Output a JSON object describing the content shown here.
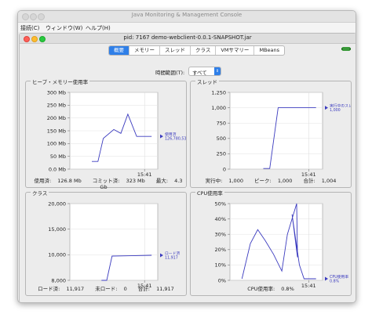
{
  "window": {
    "title": "Java Monitoring & Management Console"
  },
  "menu": [
    {
      "label": "接続(C)"
    },
    {
      "label": "ウィンドウ(W)"
    },
    {
      "label": "ヘルプ(H)"
    }
  ],
  "inner": {
    "title": "pid: 7167 demo-webclient-0.0.1-SNAPSHOT.jar"
  },
  "tabs": [
    {
      "label": "概要",
      "active": true
    },
    {
      "label": "メモリー",
      "active": false
    },
    {
      "label": "スレッド",
      "active": false
    },
    {
      "label": "クラス",
      "active": false
    },
    {
      "label": "VMサマリー",
      "active": false
    },
    {
      "label": "MBeans",
      "active": false
    }
  ],
  "time_range": {
    "label": "時間範囲(T):",
    "value": "すべて"
  },
  "colors": {
    "accent": "#2f7fe8",
    "series": "#3b3bbf",
    "plot_bg": "#ffffff"
  },
  "chart_data": [
    {
      "panel": "heap",
      "title": "ヒープ・メモリー使用率",
      "type": "line",
      "y_ticks": [
        "300 Mb",
        "250 Mb",
        "200 Mb",
        "150 Mb",
        "100 Mb",
        "50 Mb",
        "0.0 Mb"
      ],
      "ylim": [
        0,
        300
      ],
      "x_tick": "15:41",
      "points": [
        [
          0.25,
          30
        ],
        [
          0.32,
          30
        ],
        [
          0.38,
          120
        ],
        [
          0.5,
          155
        ],
        [
          0.58,
          140
        ],
        [
          0.66,
          215
        ],
        [
          0.76,
          128
        ],
        [
          0.86,
          128
        ],
        [
          0.93,
          128
        ]
      ],
      "legend": {
        "name": "使用済",
        "value": "126,780,536"
      },
      "stats": [
        {
          "label": "使用済:",
          "value": "126.8 Mb"
        },
        {
          "label": "コミット済:",
          "value": "323 Mb"
        },
        {
          "label": "最大:",
          "value": "4.3 Gb"
        }
      ]
    },
    {
      "panel": "threads",
      "title": "スレッド",
      "type": "line",
      "y_ticks": [
        "1,250",
        "1,000",
        "750",
        "500",
        "250",
        "0"
      ],
      "ylim": [
        0,
        1250
      ],
      "x_tick": "15:41",
      "points": [
        [
          0.36,
          10
        ],
        [
          0.43,
          10
        ],
        [
          0.52,
          1000
        ],
        [
          0.7,
          1000
        ],
        [
          0.93,
          1000
        ]
      ],
      "legend": {
        "name": "実行中のスレッド",
        "value": "1,000"
      },
      "stats": [
        {
          "label": "実行中:",
          "value": "1,000"
        },
        {
          "label": "ピーク:",
          "value": "1,000"
        },
        {
          "label": "合計:",
          "value": "1,004"
        }
      ]
    },
    {
      "panel": "classes",
      "title": "クラス",
      "type": "line",
      "y_ticks": [
        "20,000",
        "15,000",
        "10,000",
        "8,000"
      ],
      "ylim": [
        8000,
        20000
      ],
      "x_tick": "15:41",
      "points": [
        [
          0.36,
          8000
        ],
        [
          0.42,
          8000
        ],
        [
          0.48,
          11800
        ],
        [
          0.7,
          11850
        ],
        [
          0.93,
          11917
        ]
      ],
      "legend": {
        "name": "ロード済",
        "value": "11,917"
      },
      "stats": [
        {
          "label": "ロード済:",
          "value": "11,917"
        },
        {
          "label": "未ロード:",
          "value": "0"
        },
        {
          "label": "合計:",
          "value": "11,917"
        }
      ]
    },
    {
      "panel": "cpu",
      "title": "CPU使用率",
      "type": "line",
      "y_ticks": [
        "50%",
        "40%",
        "30%",
        "20%",
        "10%",
        "0%"
      ],
      "ylim": [
        0,
        50
      ],
      "x_tick": "15:41",
      "points": [
        [
          0.13,
          1
        ],
        [
          0.22,
          24
        ],
        [
          0.3,
          33
        ],
        [
          0.38,
          26
        ],
        [
          0.47,
          17
        ],
        [
          0.56,
          6
        ],
        [
          0.62,
          30
        ],
        [
          0.72,
          50
        ],
        [
          0.73,
          15
        ],
        [
          0.67,
          43
        ],
        [
          0.75,
          10
        ],
        [
          0.8,
          1
        ],
        [
          0.93,
          1
        ]
      ],
      "legend": {
        "name": "CPU使用率",
        "value": "0.8%"
      },
      "stats": [
        {
          "label": "CPU使用率:",
          "value": "0.8%"
        }
      ]
    }
  ]
}
